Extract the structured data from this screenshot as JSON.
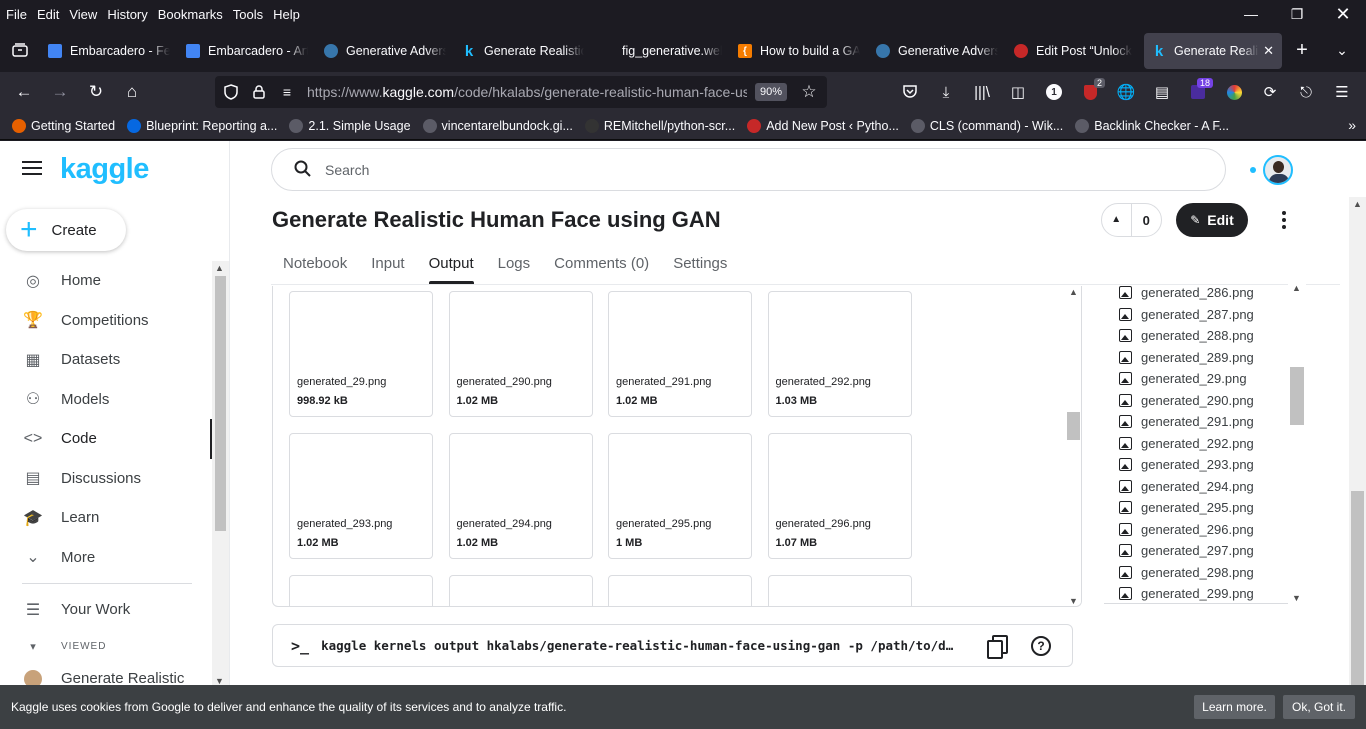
{
  "browser": {
    "menu": [
      "File",
      "Edit",
      "View",
      "History",
      "Bookmarks",
      "Tools",
      "Help"
    ],
    "window_controls": [
      "minimize-icon",
      "restore-icon",
      "close-icon"
    ],
    "tabs": [
      {
        "label": "Embarcadero - Fe",
        "favicon": "docs",
        "color": "#4285f4"
      },
      {
        "label": "Embarcadero - Art",
        "favicon": "docs",
        "color": "#4285f4"
      },
      {
        "label": "Generative Advers",
        "favicon": "python",
        "color": "#3776ab"
      },
      {
        "label": "Generate Realistic",
        "favicon": "k",
        "color": "#20beff"
      },
      {
        "label": "fig_generative.webp (",
        "favicon": "none",
        "color": "#1c1b22"
      },
      {
        "label": "How to build a GA",
        "favicon": "bracket",
        "color": "#f57c00"
      },
      {
        "label": "Generative Advers",
        "favicon": "python",
        "color": "#3776ab"
      },
      {
        "label": "Edit Post “Unlock",
        "favicon": "wp",
        "color": "#c62828"
      },
      {
        "label": "Generate Realis",
        "favicon": "k",
        "color": "#20beff",
        "active": true
      }
    ],
    "url_prefix": "https://www.",
    "url_domain": "kaggle.com",
    "url_path": "/code/hkalabs/generate-realistic-human-face-us",
    "zoom": "90%",
    "badges": {
      "ublock": "2",
      "ext": "18"
    },
    "bookmarks": [
      {
        "label": "Getting Started",
        "color": "#e66000"
      },
      {
        "label": "Blueprint: Reporting a...",
        "color": "#0668e1"
      },
      {
        "label": "2.1. Simple Usage",
        "color": "#5b5b66"
      },
      {
        "label": "vincentarelbundock.gi...",
        "color": "#5b5b66"
      },
      {
        "label": "REMitchell/python-scr...",
        "color": "#333333"
      },
      {
        "label": "Add New Post ‹ Pytho...",
        "color": "#c62828"
      },
      {
        "label": "CLS (command) - Wik...",
        "color": "#5b5b66"
      },
      {
        "label": "Backlink Checker - A F...",
        "color": "#5b5b66"
      }
    ]
  },
  "sidebar": {
    "logo": "kaggle",
    "create_label": "Create",
    "items": [
      {
        "label": "Home",
        "icon": "compass-icon",
        "glyph": "◎"
      },
      {
        "label": "Competitions",
        "icon": "trophy-icon",
        "glyph": "🏆"
      },
      {
        "label": "Datasets",
        "icon": "table-icon",
        "glyph": "▦"
      },
      {
        "label": "Models",
        "icon": "models-icon",
        "glyph": "⚇"
      },
      {
        "label": "Code",
        "icon": "code-icon",
        "glyph": "<>",
        "active": true
      },
      {
        "label": "Discussions",
        "icon": "comment-icon",
        "glyph": "▤"
      },
      {
        "label": "Learn",
        "icon": "school-icon",
        "glyph": "🎓"
      },
      {
        "label": "More",
        "icon": "chevron-down-icon",
        "glyph": "⌄"
      }
    ],
    "your_work": "Your Work",
    "viewed_label": "VIEWED",
    "viewed_item": "Generate Realistic"
  },
  "header": {
    "search_placeholder": "Search"
  },
  "notebook": {
    "title": "Generate Realistic Human Face using GAN",
    "votes": "0",
    "edit_label": "Edit",
    "tabs": [
      "Notebook",
      "Input",
      "Output",
      "Logs",
      "Comments (0)",
      "Settings"
    ],
    "active_tab": "Output"
  },
  "output_files": [
    {
      "name": "generated_29.png",
      "size": "998.92 kB"
    },
    {
      "name": "generated_290.png",
      "size": "1.02 MB"
    },
    {
      "name": "generated_291.png",
      "size": "1.02 MB"
    },
    {
      "name": "generated_292.png",
      "size": "1.03 MB"
    },
    {
      "name": "generated_293.png",
      "size": "1.02 MB"
    },
    {
      "name": "generated_294.png",
      "size": "1.02 MB"
    },
    {
      "name": "generated_295.png",
      "size": "1 MB"
    },
    {
      "name": "generated_296.png",
      "size": "1.07 MB"
    },
    {
      "name": "",
      "size": ""
    },
    {
      "name": "",
      "size": ""
    },
    {
      "name": "",
      "size": ""
    },
    {
      "name": "",
      "size": ""
    }
  ],
  "file_tree": [
    "generated_286.png",
    "generated_287.png",
    "generated_288.png",
    "generated_289.png",
    "generated_29.png",
    "generated_290.png",
    "generated_291.png",
    "generated_292.png",
    "generated_293.png",
    "generated_294.png",
    "generated_295.png",
    "generated_296.png",
    "generated_297.png",
    "generated_298.png",
    "generated_299.png"
  ],
  "command": {
    "prompt": ">_",
    "text": "kaggle kernels output hkalabs/generate-realistic-human-face-using-gan -p /path/to/d…"
  },
  "cookie": {
    "text": "Kaggle uses cookies from Google to deliver and enhance the quality of its services and to analyze traffic.",
    "learn_more": "Learn more.",
    "ok": "Ok, Got it."
  }
}
